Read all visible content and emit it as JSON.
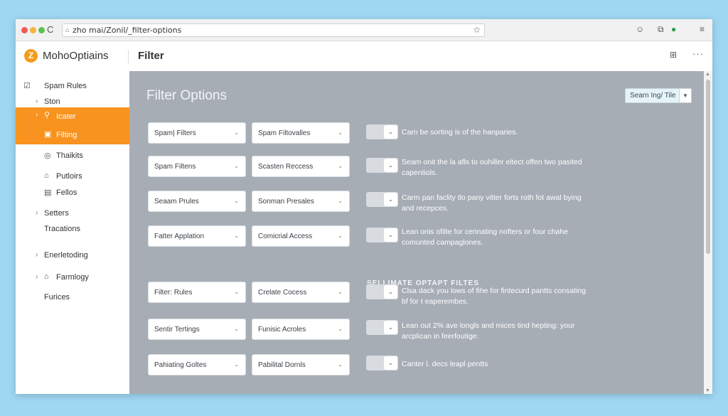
{
  "browser": {
    "url": "zho mai/Zonil/_filter-options",
    "reload_icon": "C",
    "star_icon": "☆",
    "extensions": [
      "☺",
      "⧉",
      "●",
      "≡"
    ]
  },
  "header": {
    "logo_letter": "Z",
    "brand": "MohoOptiains",
    "title": "Filter",
    "grid_icon": "⊞",
    "more_icon": "···"
  },
  "sidebar": {
    "items": [
      {
        "label": "Spam Rules",
        "icon": "☑",
        "chevron": "",
        "active": false
      },
      {
        "label": "Ston",
        "icon": "",
        "chevron": "›",
        "active": false
      },
      {
        "label": "Icater",
        "icon": "⚲",
        "chevron": "›",
        "active": true
      },
      {
        "label": "Filting",
        "icon": "▣",
        "chevron": "",
        "active": true
      },
      {
        "label": "Thaikits",
        "icon": "◎",
        "chevron": "",
        "active": false
      },
      {
        "label": "Putloirs",
        "icon": "⌂",
        "chevron": "",
        "active": false
      },
      {
        "label": "Fellos",
        "icon": "▤",
        "chevron": "",
        "active": false
      },
      {
        "label": "Setters",
        "icon": "",
        "chevron": "›",
        "active": false
      },
      {
        "label": "Tracations",
        "icon": "",
        "chevron": "",
        "active": false
      },
      {
        "label": "Enerletoding",
        "icon": "",
        "chevron": "›",
        "active": false
      },
      {
        "label": "Farmlogy",
        "icon": "⌂",
        "chevron": "›",
        "active": false
      },
      {
        "label": "Furices",
        "icon": "",
        "chevron": "",
        "active": false
      }
    ]
  },
  "main": {
    "title": "Filter Options",
    "view_select": "Searn Ing/ Tile",
    "section_label": "SELLIMATE OPTAPT FILTES",
    "rows": [
      {
        "left": "Spam| Filters",
        "right": "Spam Filtovalles",
        "desc": "Carn be sorting is of the hanparies."
      },
      {
        "left": "Spam Filtens",
        "right": "Scasten Reccess",
        "desc": "Seam onit the la afls to ouhiller eltect offen two pasited capentiols."
      },
      {
        "left": "Seaam Prules",
        "right": "Sonman Presales",
        "desc": "Carm pan faclity tlo pany vitter forts roth fot awal bying and recepces."
      },
      {
        "left": "Fatter Applation",
        "right": "Comicrial Access",
        "desc": "Lean onis ofilte for cerinating nofters or four chahe comunted campaglones."
      },
      {
        "left": "Filter: Rules",
        "right": "Crelate Cocess",
        "desc": "Clsa dack you lows of fihe for fintecurd pantts consating bf for t eaperembes."
      },
      {
        "left": "Sentir Tertings",
        "right": "Funisic Acroles",
        "desc": "Lean out 2% ave longls and mices tind hepting: your arcplican in feerfoutige."
      },
      {
        "left": "Pahiating Goltes",
        "right": "Pabilital Dornls",
        "desc": "Canter l. decs leapl pentts"
      }
    ]
  },
  "icons": {
    "dropdown": "chevron-down-icon",
    "toggle": "chevron-down-icon"
  },
  "colors": {
    "accent": "#f7931e",
    "main_bg": "#a6adb5",
    "page_bg": "#9fd6f2"
  }
}
